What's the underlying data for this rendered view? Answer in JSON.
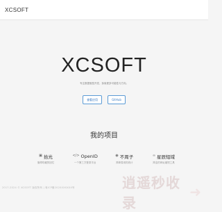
{
  "navbar": {
    "brand": "XCSOFT"
  },
  "hero": {
    "title": "XCSOFT",
    "subtitle": "专注数据驱型开发，探索更多可能性与方向。",
    "buttons": [
      {
        "label": "查看应用"
      },
      {
        "label": "GitHub"
      }
    ]
  },
  "projects_section": {
    "title": "我的项目",
    "items": [
      {
        "icon": "image-icon",
        "title": "拾光",
        "desc": "值得珍藏的回忆"
      },
      {
        "icon": "code-icon",
        "title": "OpenID",
        "desc": "一个第三方登录平台"
      },
      {
        "icon": "robot-icon",
        "title": "不周子",
        "desc": "简单易用的统计"
      },
      {
        "icon": "link-icon",
        "title": "星辰短域",
        "desc": "简洁的网址缩短工具"
      }
    ]
  },
  "footer": {
    "text": "2017-2024 © XCSOFT 版权所有 | 粤ICP备2020XXXXXX号"
  },
  "watermark": {
    "text": "逍遥秒收录"
  },
  "colors": {
    "accent": "#3a7cc3",
    "background": "#f5f5f5"
  }
}
